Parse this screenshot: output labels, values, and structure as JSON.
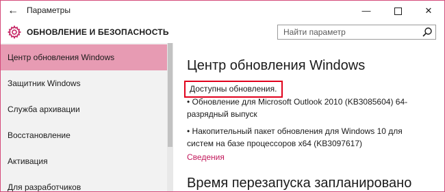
{
  "window": {
    "title": "Параметры",
    "back_icon": "←",
    "minimize_icon": "—",
    "close_icon": "✕",
    "accent_border": "#d44a7a"
  },
  "header": {
    "section_title": "ОБНОВЛЕНИЕ И БЕЗОПАСНОСТЬ",
    "search_placeholder": "Найти параметр",
    "gear_color": "#c2185b"
  },
  "sidebar": {
    "items": [
      {
        "label": "Центр обновления Windows",
        "active": true
      },
      {
        "label": "Защитник Windows",
        "active": false
      },
      {
        "label": "Служба архивации",
        "active": false
      },
      {
        "label": "Восстановление",
        "active": false
      },
      {
        "label": "Активация",
        "active": false
      },
      {
        "label": "Для разработчиков",
        "active": false
      }
    ],
    "active_color": "#e79bb3"
  },
  "content": {
    "title": "Центр обновления Windows",
    "status": "Доступны обновления.",
    "updates": [
      "• Обновление для Microsoft Outlook 2010 (KB3085604) 64-разрядный выпуск",
      "• Накопительный пакет обновления для Windows 10 для систем на базе процессоров x64 (KB3097617)"
    ],
    "details_link": "Сведения",
    "restart_title": "Время перезапуска запланировано",
    "link_color": "#c2185b",
    "highlight_color": "#e0001b"
  }
}
